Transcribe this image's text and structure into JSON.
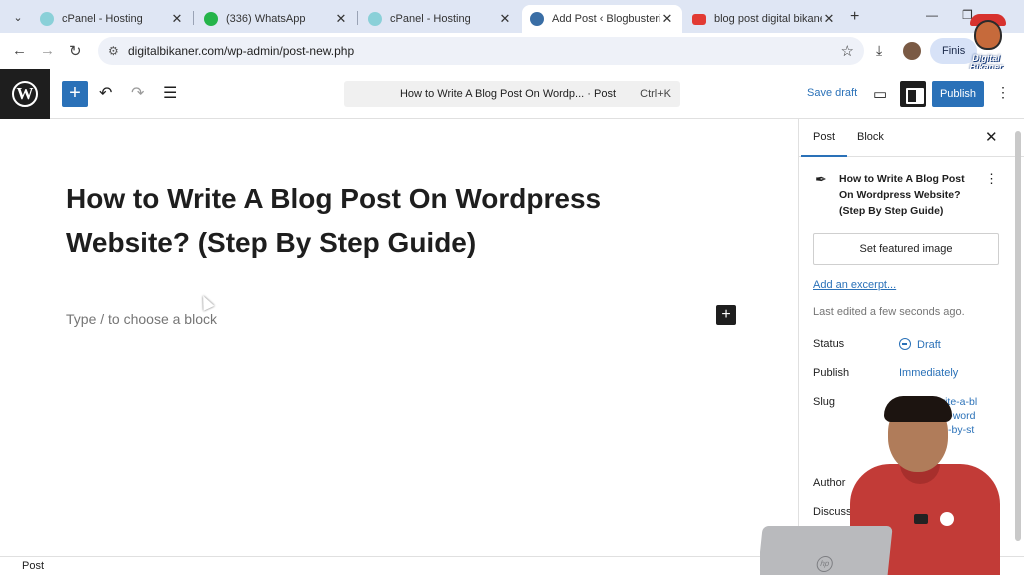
{
  "browser": {
    "tabs": [
      {
        "title": "cPanel - Hosting",
        "active": false
      },
      {
        "title": "(336) WhatsApp",
        "active": false
      },
      {
        "title": "cPanel - Hosting",
        "active": false
      },
      {
        "title": "Add Post ‹ Blogbusterify",
        "active": true
      },
      {
        "title": "blog post digital bikaner",
        "active": false
      }
    ],
    "url": "digitalbikaner.com/wp-admin/post-new.php",
    "finish_label": "Finis",
    "watermark": "Digital Bikaner"
  },
  "editor": {
    "command_center_title": "How to Write A Blog Post On Wordp... · Post",
    "command_center_shortcut": "Ctrl+K",
    "save_draft": "Save draft",
    "publish": "Publish",
    "post_title": "How to Write A Blog Post On Wordpress Website? (Step By Step Guide)",
    "block_placeholder": "Type / to choose a block"
  },
  "sidebar": {
    "tab_post": "Post",
    "tab_block": "Block",
    "doc_title": "How to Write A Blog Post On Wordpress Website? (Step By Step Guide)",
    "featured_image": "Set featured image",
    "add_excerpt": "Add an excerpt...",
    "last_edited": "Last edited a few seconds ago.",
    "status_label": "Status",
    "status_value": "Draft",
    "publish_label": "Publish",
    "publish_value": "Immediately",
    "slug_label": "Slug",
    "slug_value": "how-to-write-a-blog-post-on-wordpress-step-by-step",
    "author_label": "Author",
    "discussion_label": "Discussio"
  },
  "footer": {
    "breadcrumb": "Post"
  },
  "colors": {
    "accent": "#2a71b8",
    "dark": "#1e1e1e",
    "tabstrip": "#dfe6f4"
  }
}
